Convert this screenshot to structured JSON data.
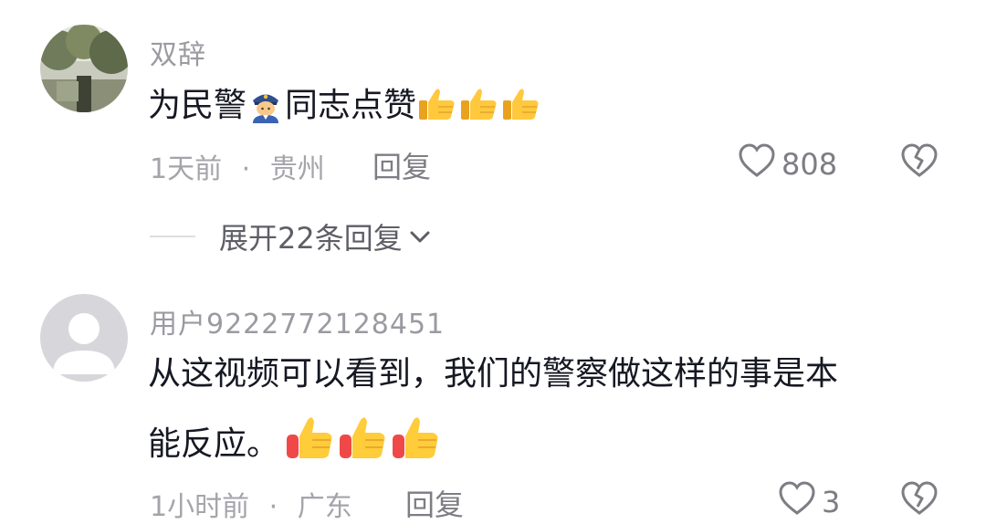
{
  "comments": [
    {
      "username": "双辞",
      "text_before_icon": "为民警",
      "text_after_icon": "同志点赞",
      "time": "1天前",
      "separator": "·",
      "location": "贵州",
      "reply_label": "回复",
      "like_count": "808",
      "expand_replies_label": "展开22条回复"
    },
    {
      "username": "用户9222772128451",
      "text_line1": "从这视频可以看到，我们的警察做这样的事是本",
      "text_line2": "能反应。",
      "time": "1小时前",
      "separator": "·",
      "location": "广东",
      "reply_label": "回复",
      "like_count": "3"
    }
  ],
  "icons": {
    "like": "heart-outline-icon",
    "dislike": "broken-heart-icon",
    "expand": "chevron-down-icon",
    "police": "police-officer-emoji",
    "thumbs": "thumbs-up-emoji"
  }
}
